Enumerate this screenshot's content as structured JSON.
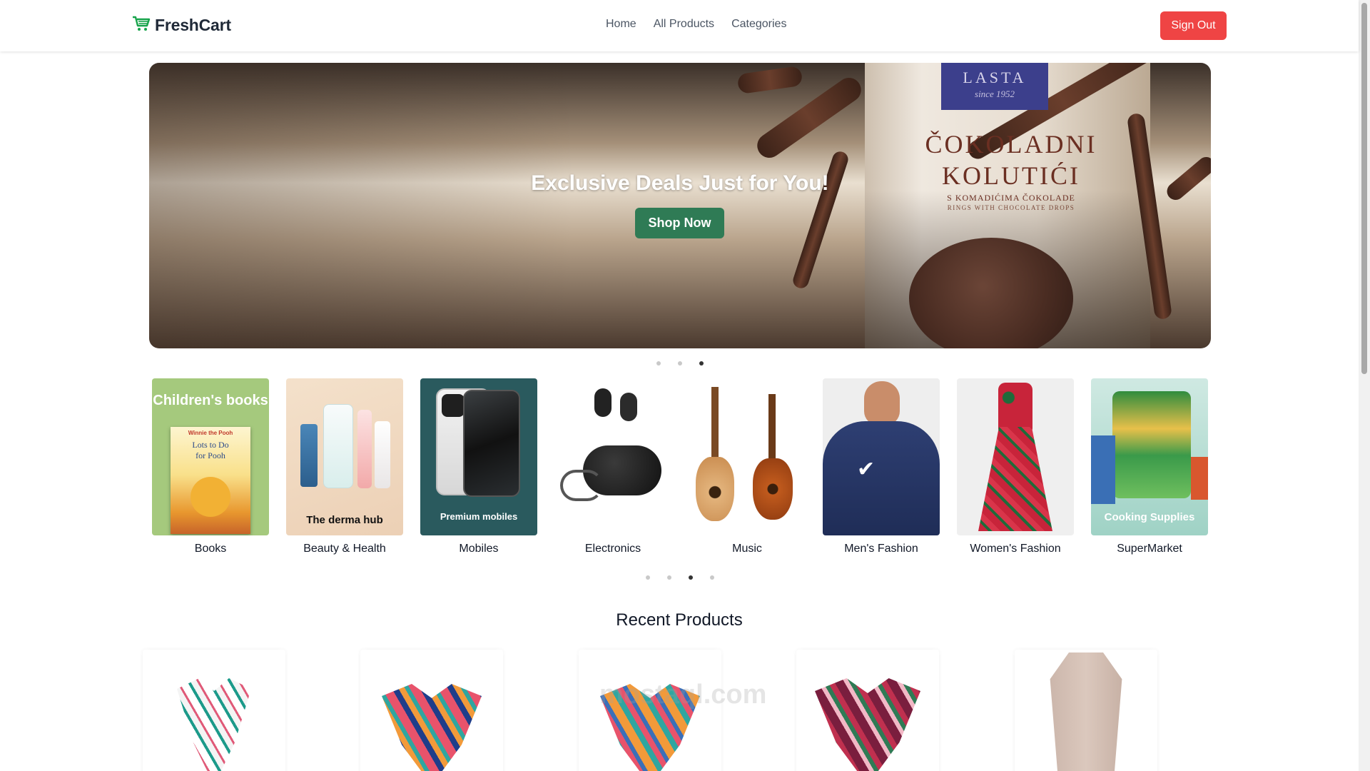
{
  "navbar": {
    "brand": "FreshCart",
    "links": [
      "Home",
      "All Products",
      "Categories"
    ],
    "signout_label": "Sign Out"
  },
  "hero": {
    "title": "Exclusive Deals Just for You!",
    "button_label": "Shop Now",
    "packaging": {
      "brand": "LASTA",
      "since": "since 1952",
      "product_line1": "ČOKOLADNI",
      "product_line2": "KOLUTIĆI",
      "sub1": "S KOMADIĆIMA ČOKOLADE",
      "sub2": "RINGS WITH CHOCOLATE DROPS"
    },
    "slides_count": 3,
    "active_slide": 3
  },
  "categories": {
    "items": [
      {
        "name": "Books",
        "caption": "Children's books"
      },
      {
        "name": "Beauty & Health",
        "caption": "The derma hub"
      },
      {
        "name": "Mobiles",
        "caption": "Premium mobiles"
      },
      {
        "name": "Electronics",
        "caption": ""
      },
      {
        "name": "Music",
        "caption": ""
      },
      {
        "name": "Men's Fashion",
        "caption": ""
      },
      {
        "name": "Women's Fashion",
        "caption": ""
      },
      {
        "name": "SuperMarket",
        "caption": "Cooking Supplies"
      }
    ],
    "book_cover": {
      "brand": "Winnie the Pooh",
      "title1": "Lots to Do",
      "title2": "for Pooh"
    },
    "pages_count": 4,
    "active_page": 3
  },
  "recent_products": {
    "title": "Recent Products",
    "items": [
      {
        "name": "scarf-white-teal"
      },
      {
        "name": "scarf-pink-navy"
      },
      {
        "name": "scarf-orange-teal"
      },
      {
        "name": "scarf-burgundy"
      },
      {
        "name": "scarf-beige"
      }
    ]
  },
  "watermark": "mostaql.com",
  "colors": {
    "brand_green": "#2f7b55",
    "signout_red": "#ef4444",
    "cart_icon_green": "#16a34a"
  }
}
